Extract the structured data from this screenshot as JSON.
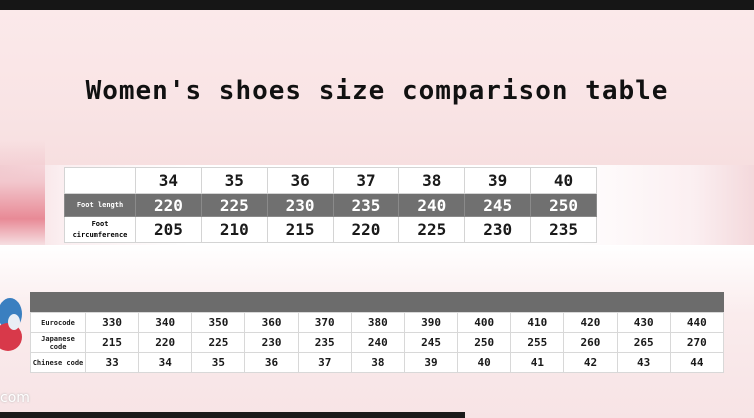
{
  "page": {
    "title": "Women's shoes size comparison table",
    "brand_fragment": "com"
  },
  "table1": {
    "columns": [
      "34",
      "35",
      "36",
      "37",
      "38",
      "39",
      "40"
    ],
    "rows": [
      {
        "label": "Foot length",
        "values": [
          "220",
          "225",
          "230",
          "235",
          "240",
          "245",
          "250"
        ]
      },
      {
        "label": "Foot circumference",
        "values": [
          "205",
          "210",
          "215",
          "220",
          "225",
          "230",
          "235"
        ]
      }
    ]
  },
  "table2": {
    "rows": [
      {
        "label": "Eurocode",
        "values": [
          "330",
          "340",
          "350",
          "360",
          "370",
          "380",
          "390",
          "400",
          "410",
          "420",
          "430",
          "440"
        ]
      },
      {
        "label": "Japanese code",
        "values": [
          "215",
          "220",
          "225",
          "230",
          "235",
          "240",
          "245",
          "250",
          "255",
          "260",
          "265",
          "270"
        ]
      },
      {
        "label": "Chinese code",
        "values": [
          "33",
          "34",
          "35",
          "36",
          "37",
          "38",
          "39",
          "40",
          "41",
          "42",
          "43",
          "44"
        ]
      }
    ]
  },
  "colors": {
    "header_bar": "#6c6c6c",
    "foot_length_row": "#707070",
    "pink_background": "#fbe9ea"
  }
}
